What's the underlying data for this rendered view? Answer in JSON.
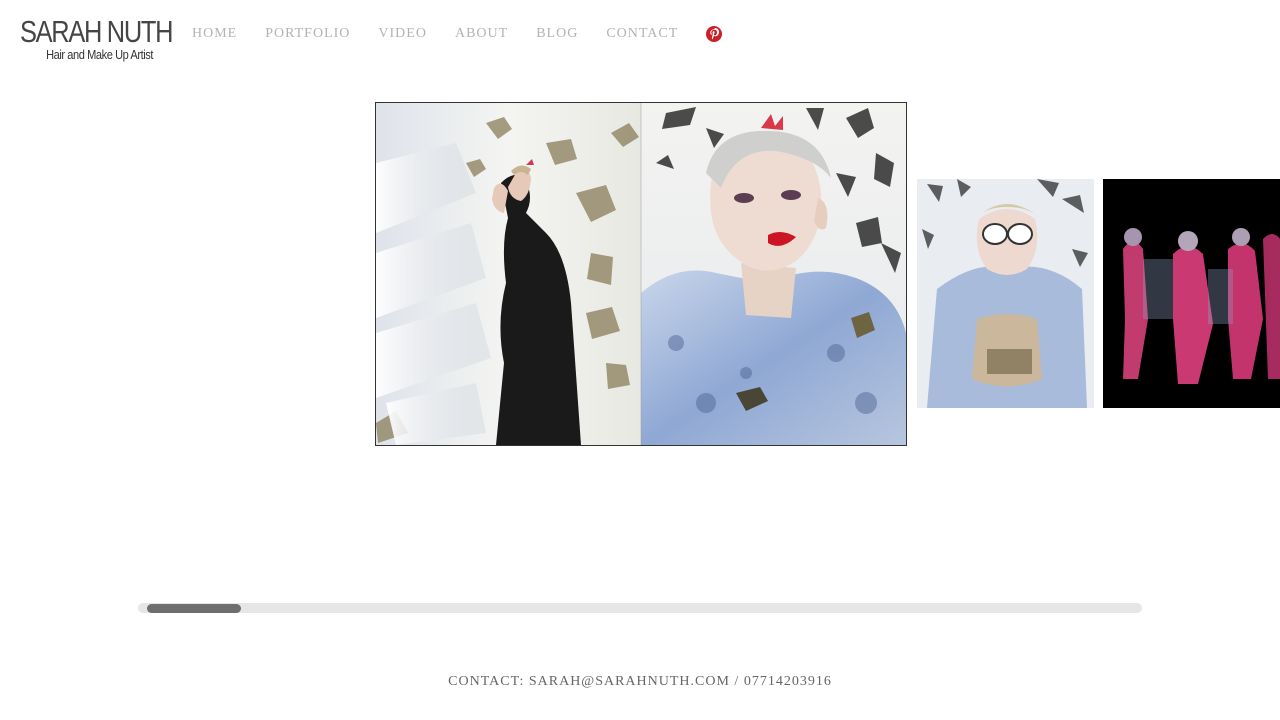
{
  "brand": {
    "name": "SARAH NUTH",
    "tagline": "Hair and Make Up Artist"
  },
  "nav": {
    "items": [
      {
        "label": "HOME"
      },
      {
        "label": "PORTFOLIO"
      },
      {
        "label": "VIDEO"
      },
      {
        "label": "ABOUT"
      },
      {
        "label": "BLOG"
      },
      {
        "label": "CONTACT"
      }
    ],
    "social_icon": "pinterest-icon"
  },
  "gallery": {
    "scroll_position_fraction": 0.0
  },
  "footer": {
    "text": "CONTACT: SARAH@SARAHNUTH.COM / 07714203916"
  },
  "colors": {
    "nav_text": "#b3b3b3",
    "logo_text": "#454545",
    "pinterest_red": "#cb2027",
    "scroll_track": "#e6e6e6",
    "scroll_thumb": "#6e6e6e",
    "footer_text": "#666666"
  }
}
